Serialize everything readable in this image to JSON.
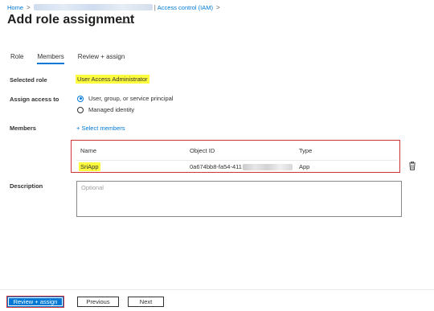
{
  "breadcrumb": {
    "home": "Home",
    "current": "Access control (IAM)",
    "separator": ">",
    "pipe": "|"
  },
  "page": {
    "title": "Add role assignment",
    "more": "..."
  },
  "tabs": [
    {
      "label": "Role",
      "active": false
    },
    {
      "label": "Members",
      "active": true
    },
    {
      "label": "Review + assign",
      "active": false
    }
  ],
  "selected_role": {
    "label": "Selected role",
    "value": "User Access Administrator"
  },
  "assign_access": {
    "label": "Assign access to",
    "options": [
      {
        "label": "User, group, or service principal",
        "checked": true
      },
      {
        "label": "Managed identity",
        "checked": false
      }
    ]
  },
  "members": {
    "label": "Members",
    "select_link": "+ Select members",
    "columns": [
      "Name",
      "Object ID",
      "Type"
    ],
    "rows": [
      {
        "name": "SriApp",
        "object_id": "0a674bb8-fa54-411",
        "type": "App"
      }
    ]
  },
  "description": {
    "label": "Description",
    "placeholder": "Optional"
  },
  "footer": {
    "review_assign": "Review + assign",
    "previous": "Previous",
    "next": "Next"
  },
  "colors": {
    "accent": "#0078d4",
    "highlight": "#fdfc3f",
    "annotation_red": "#d13438"
  },
  "icons": {
    "delete": "trash-icon"
  }
}
